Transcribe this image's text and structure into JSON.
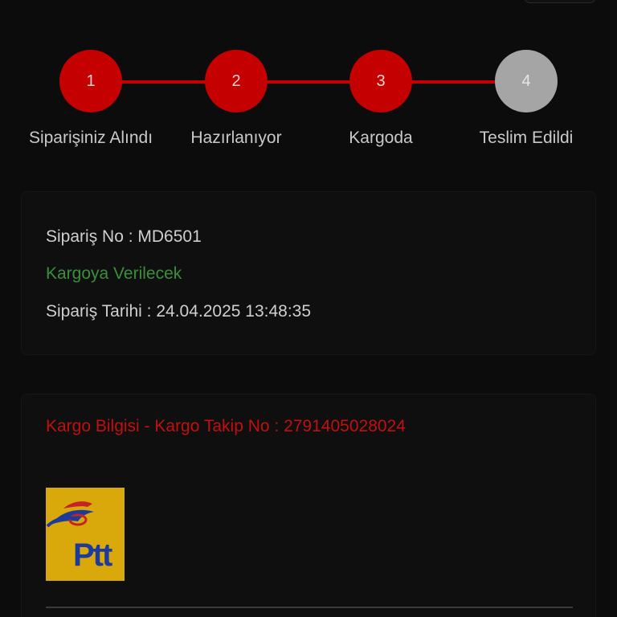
{
  "stepper": {
    "steps": [
      {
        "number": "1",
        "label": "Siparişiniz Alındı",
        "state": "done"
      },
      {
        "number": "2",
        "label": "Hazırlanıyor",
        "state": "done"
      },
      {
        "number": "3",
        "label": "Kargoda",
        "state": "done"
      },
      {
        "number": "4",
        "label": "Teslim Edildi",
        "state": "pending"
      }
    ],
    "colors": {
      "active": "#c40000",
      "inactive": "#a5a5a5"
    }
  },
  "order": {
    "order_no": "Sipariş No : MD6501",
    "status": "Kargoya Verilecek",
    "order_date": "Sipariş Tarihi : 24.04.2025 13:48:35",
    "status_color": "#3a8f3a"
  },
  "cargo": {
    "title": "Kargo Bilgisi - Kargo Takip No : 2791405028024",
    "title_color": "#c30f0f",
    "carrier_logo": "ptt-logo",
    "carrier_logo_text": "Ptt"
  }
}
